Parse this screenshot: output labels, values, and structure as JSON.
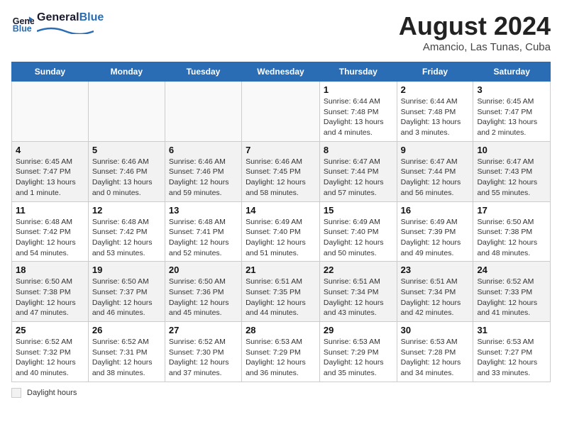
{
  "logo": {
    "text_general": "General",
    "text_blue": "Blue"
  },
  "title": "August 2024",
  "location": "Amancio, Las Tunas, Cuba",
  "days_of_week": [
    "Sunday",
    "Monday",
    "Tuesday",
    "Wednesday",
    "Thursday",
    "Friday",
    "Saturday"
  ],
  "legend_label": "Daylight hours",
  "weeks": [
    [
      {
        "day": "",
        "info": "",
        "empty": true
      },
      {
        "day": "",
        "info": "",
        "empty": true
      },
      {
        "day": "",
        "info": "",
        "empty": true
      },
      {
        "day": "",
        "info": "",
        "empty": true
      },
      {
        "day": "1",
        "info": "Sunrise: 6:44 AM\nSunset: 7:48 PM\nDaylight: 13 hours\nand 4 minutes."
      },
      {
        "day": "2",
        "info": "Sunrise: 6:44 AM\nSunset: 7:48 PM\nDaylight: 13 hours\nand 3 minutes."
      },
      {
        "day": "3",
        "info": "Sunrise: 6:45 AM\nSunset: 7:47 PM\nDaylight: 13 hours\nand 2 minutes."
      }
    ],
    [
      {
        "day": "4",
        "info": "Sunrise: 6:45 AM\nSunset: 7:47 PM\nDaylight: 13 hours\nand 1 minute."
      },
      {
        "day": "5",
        "info": "Sunrise: 6:46 AM\nSunset: 7:46 PM\nDaylight: 13 hours\nand 0 minutes."
      },
      {
        "day": "6",
        "info": "Sunrise: 6:46 AM\nSunset: 7:46 PM\nDaylight: 12 hours\nand 59 minutes."
      },
      {
        "day": "7",
        "info": "Sunrise: 6:46 AM\nSunset: 7:45 PM\nDaylight: 12 hours\nand 58 minutes."
      },
      {
        "day": "8",
        "info": "Sunrise: 6:47 AM\nSunset: 7:44 PM\nDaylight: 12 hours\nand 57 minutes."
      },
      {
        "day": "9",
        "info": "Sunrise: 6:47 AM\nSunset: 7:44 PM\nDaylight: 12 hours\nand 56 minutes."
      },
      {
        "day": "10",
        "info": "Sunrise: 6:47 AM\nSunset: 7:43 PM\nDaylight: 12 hours\nand 55 minutes."
      }
    ],
    [
      {
        "day": "11",
        "info": "Sunrise: 6:48 AM\nSunset: 7:42 PM\nDaylight: 12 hours\nand 54 minutes."
      },
      {
        "day": "12",
        "info": "Sunrise: 6:48 AM\nSunset: 7:42 PM\nDaylight: 12 hours\nand 53 minutes."
      },
      {
        "day": "13",
        "info": "Sunrise: 6:48 AM\nSunset: 7:41 PM\nDaylight: 12 hours\nand 52 minutes."
      },
      {
        "day": "14",
        "info": "Sunrise: 6:49 AM\nSunset: 7:40 PM\nDaylight: 12 hours\nand 51 minutes."
      },
      {
        "day": "15",
        "info": "Sunrise: 6:49 AM\nSunset: 7:40 PM\nDaylight: 12 hours\nand 50 minutes."
      },
      {
        "day": "16",
        "info": "Sunrise: 6:49 AM\nSunset: 7:39 PM\nDaylight: 12 hours\nand 49 minutes."
      },
      {
        "day": "17",
        "info": "Sunrise: 6:50 AM\nSunset: 7:38 PM\nDaylight: 12 hours\nand 48 minutes."
      }
    ],
    [
      {
        "day": "18",
        "info": "Sunrise: 6:50 AM\nSunset: 7:38 PM\nDaylight: 12 hours\nand 47 minutes."
      },
      {
        "day": "19",
        "info": "Sunrise: 6:50 AM\nSunset: 7:37 PM\nDaylight: 12 hours\nand 46 minutes."
      },
      {
        "day": "20",
        "info": "Sunrise: 6:50 AM\nSunset: 7:36 PM\nDaylight: 12 hours\nand 45 minutes."
      },
      {
        "day": "21",
        "info": "Sunrise: 6:51 AM\nSunset: 7:35 PM\nDaylight: 12 hours\nand 44 minutes."
      },
      {
        "day": "22",
        "info": "Sunrise: 6:51 AM\nSunset: 7:34 PM\nDaylight: 12 hours\nand 43 minutes."
      },
      {
        "day": "23",
        "info": "Sunrise: 6:51 AM\nSunset: 7:34 PM\nDaylight: 12 hours\nand 42 minutes."
      },
      {
        "day": "24",
        "info": "Sunrise: 6:52 AM\nSunset: 7:33 PM\nDaylight: 12 hours\nand 41 minutes."
      }
    ],
    [
      {
        "day": "25",
        "info": "Sunrise: 6:52 AM\nSunset: 7:32 PM\nDaylight: 12 hours\nand 40 minutes."
      },
      {
        "day": "26",
        "info": "Sunrise: 6:52 AM\nSunset: 7:31 PM\nDaylight: 12 hours\nand 38 minutes."
      },
      {
        "day": "27",
        "info": "Sunrise: 6:52 AM\nSunset: 7:30 PM\nDaylight: 12 hours\nand 37 minutes."
      },
      {
        "day": "28",
        "info": "Sunrise: 6:53 AM\nSunset: 7:29 PM\nDaylight: 12 hours\nand 36 minutes."
      },
      {
        "day": "29",
        "info": "Sunrise: 6:53 AM\nSunset: 7:29 PM\nDaylight: 12 hours\nand 35 minutes."
      },
      {
        "day": "30",
        "info": "Sunrise: 6:53 AM\nSunset: 7:28 PM\nDaylight: 12 hours\nand 34 minutes."
      },
      {
        "day": "31",
        "info": "Sunrise: 6:53 AM\nSunset: 7:27 PM\nDaylight: 12 hours\nand 33 minutes."
      }
    ]
  ]
}
